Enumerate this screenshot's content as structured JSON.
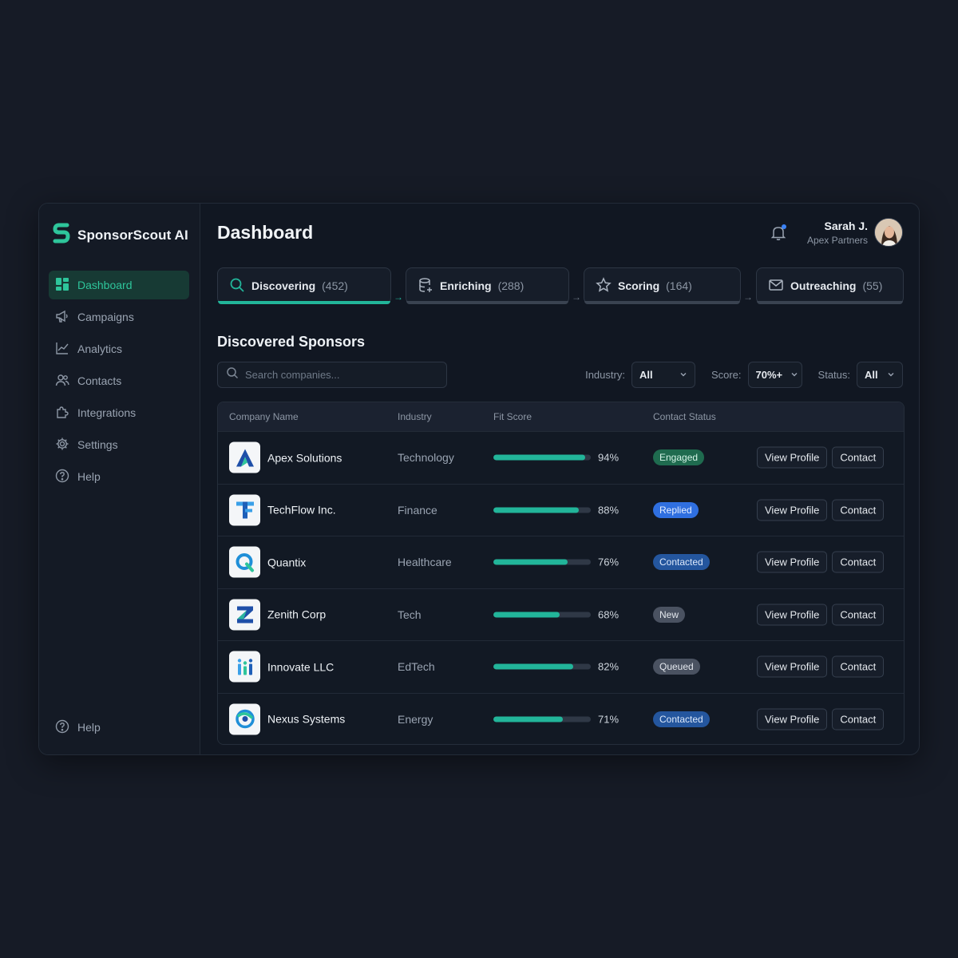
{
  "app": {
    "name": "SponsorScout AI"
  },
  "sidebar": {
    "items": [
      {
        "label": "Dashboard",
        "icon": "dashboard-grid-icon",
        "active": true
      },
      {
        "label": "Campaigns",
        "icon": "megaphone-icon"
      },
      {
        "label": "Analytics",
        "icon": "line-chart-icon"
      },
      {
        "label": "Contacts",
        "icon": "users-icon"
      },
      {
        "label": "Integrations",
        "icon": "puzzle-icon"
      },
      {
        "label": "Settings",
        "icon": "gear-icon"
      },
      {
        "label": "Help",
        "icon": "help-circle-icon"
      }
    ],
    "bottom_help": "Help"
  },
  "header": {
    "title": "Dashboard",
    "user": {
      "name": "Sarah J.",
      "org": "Apex Partners"
    }
  },
  "pipeline": [
    {
      "label": "Discovering",
      "count": "(452)",
      "icon": "search-icon",
      "active": true
    },
    {
      "label": "Enriching",
      "count": "(288)",
      "icon": "database-icon",
      "active": false
    },
    {
      "label": "Scoring",
      "count": "(164)",
      "icon": "star-icon",
      "active": false
    },
    {
      "label": "Outreaching",
      "count": "(55)",
      "icon": "mail-icon",
      "active": false
    }
  ],
  "section": {
    "title": "Discovered Sponsors"
  },
  "search": {
    "placeholder": "Search companies..."
  },
  "filters": {
    "industry": {
      "label": "Industry:",
      "value": "All"
    },
    "score": {
      "label": "Score:",
      "value": "70%+"
    },
    "status": {
      "label": "Status:",
      "value": "All"
    }
  },
  "table": {
    "headers": {
      "company": "Company Name",
      "industry": "Industry",
      "fit": "Fit Score",
      "status": "Contact Status"
    },
    "view_label": "View Profile",
    "contact_label": "Contact",
    "rows": [
      {
        "company": "Apex Solutions",
        "industry": "Technology",
        "score": 94,
        "score_text": "94%",
        "status": "Engaged"
      },
      {
        "company": "TechFlow Inc.",
        "industry": "Finance",
        "score": 88,
        "score_text": "88%",
        "status": "Replied"
      },
      {
        "company": "Quantix",
        "industry": "Healthcare",
        "score": 76,
        "score_text": "76%",
        "status": "Contacted"
      },
      {
        "company": "Zenith Corp",
        "industry": "Tech",
        "score": 68,
        "score_text": "68%",
        "status": "New"
      },
      {
        "company": "Innovate LLC",
        "industry": "EdTech",
        "score": 82,
        "score_text": "82%",
        "status": "Queued"
      },
      {
        "company": "Nexus Systems",
        "industry": "Energy",
        "score": 71,
        "score_text": "71%",
        "status": "Contacted"
      }
    ]
  },
  "colors": {
    "accent": "#22b59a",
    "engaged": "#1f6b4f",
    "replied": "#2f6fe0",
    "contacted": "#24569e",
    "new": "#4a5261",
    "queued": "#4a5261"
  }
}
